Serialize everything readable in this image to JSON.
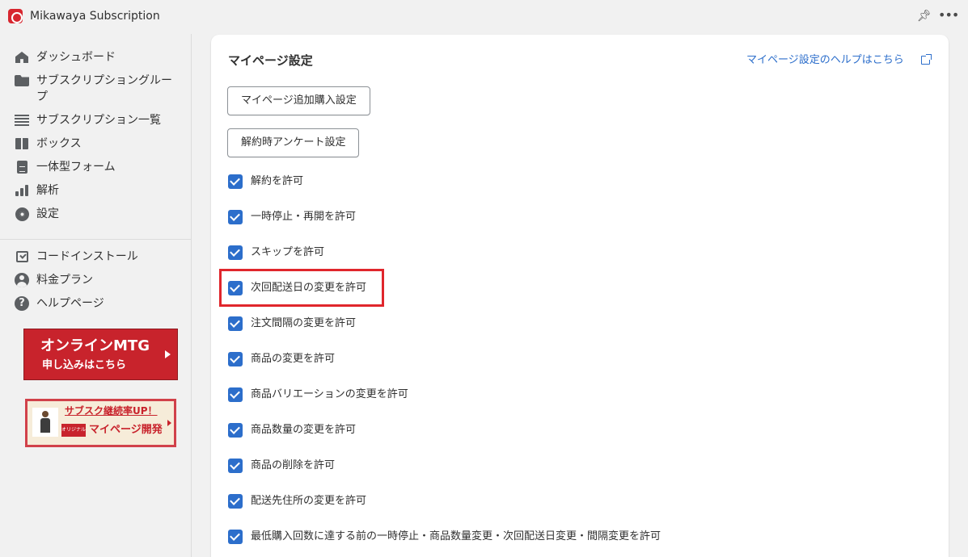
{
  "app": {
    "title": "Mikawaya Subscription",
    "accent_color": "#2c6ecb",
    "brand_color": "#c8232c"
  },
  "sidebar": {
    "items": [
      {
        "label": "ダッシュボード",
        "icon": "home-icon"
      },
      {
        "label": "サブスクリプショングループ",
        "icon": "folder-icon"
      },
      {
        "label": "サブスクリプション一覧",
        "icon": "list-icon"
      },
      {
        "label": "ボックス",
        "icon": "gift-icon"
      },
      {
        "label": "一体型フォーム",
        "icon": "document-icon"
      },
      {
        "label": "解析",
        "icon": "bar-chart-icon"
      },
      {
        "label": "設定",
        "icon": "gear-icon"
      }
    ],
    "secondary_items": [
      {
        "label": "コードインストール",
        "icon": "install-icon"
      },
      {
        "label": "料金プラン",
        "icon": "user-icon"
      },
      {
        "label": "ヘルプページ",
        "icon": "help-icon"
      }
    ],
    "banner_mtg": {
      "line1": "オンラインMTG",
      "line2": "申し込みはこちら"
    },
    "banner_mypage": {
      "line1": "サブスク継続率UP！",
      "badge": "オリジナル",
      "line2": "マイページ開発"
    }
  },
  "main": {
    "title": "マイページ設定",
    "help_link": "マイページ設定のヘルプはこちら",
    "buttons": [
      {
        "label": "マイページ追加購入設定"
      },
      {
        "label": "解約時アンケート設定"
      }
    ],
    "checkboxes": [
      {
        "label": "解約を許可",
        "checked": true
      },
      {
        "label": "一時停止・再開を許可",
        "checked": true
      },
      {
        "label": "スキップを許可",
        "checked": true
      },
      {
        "label": "次回配送日の変更を許可",
        "checked": true
      },
      {
        "label": "注文間隔の変更を許可",
        "checked": true
      },
      {
        "label": "商品の変更を許可",
        "checked": true
      },
      {
        "label": "商品バリエーションの変更を許可",
        "checked": true
      },
      {
        "label": "商品数量の変更を許可",
        "checked": true
      },
      {
        "label": "商品の削除を許可",
        "checked": true
      },
      {
        "label": "配送先住所の変更を許可",
        "checked": true
      },
      {
        "label": "最低購入回数に達する前の一時停止・商品数量変更・次回配送日変更・間隔変更を許可",
        "checked": true
      }
    ]
  }
}
